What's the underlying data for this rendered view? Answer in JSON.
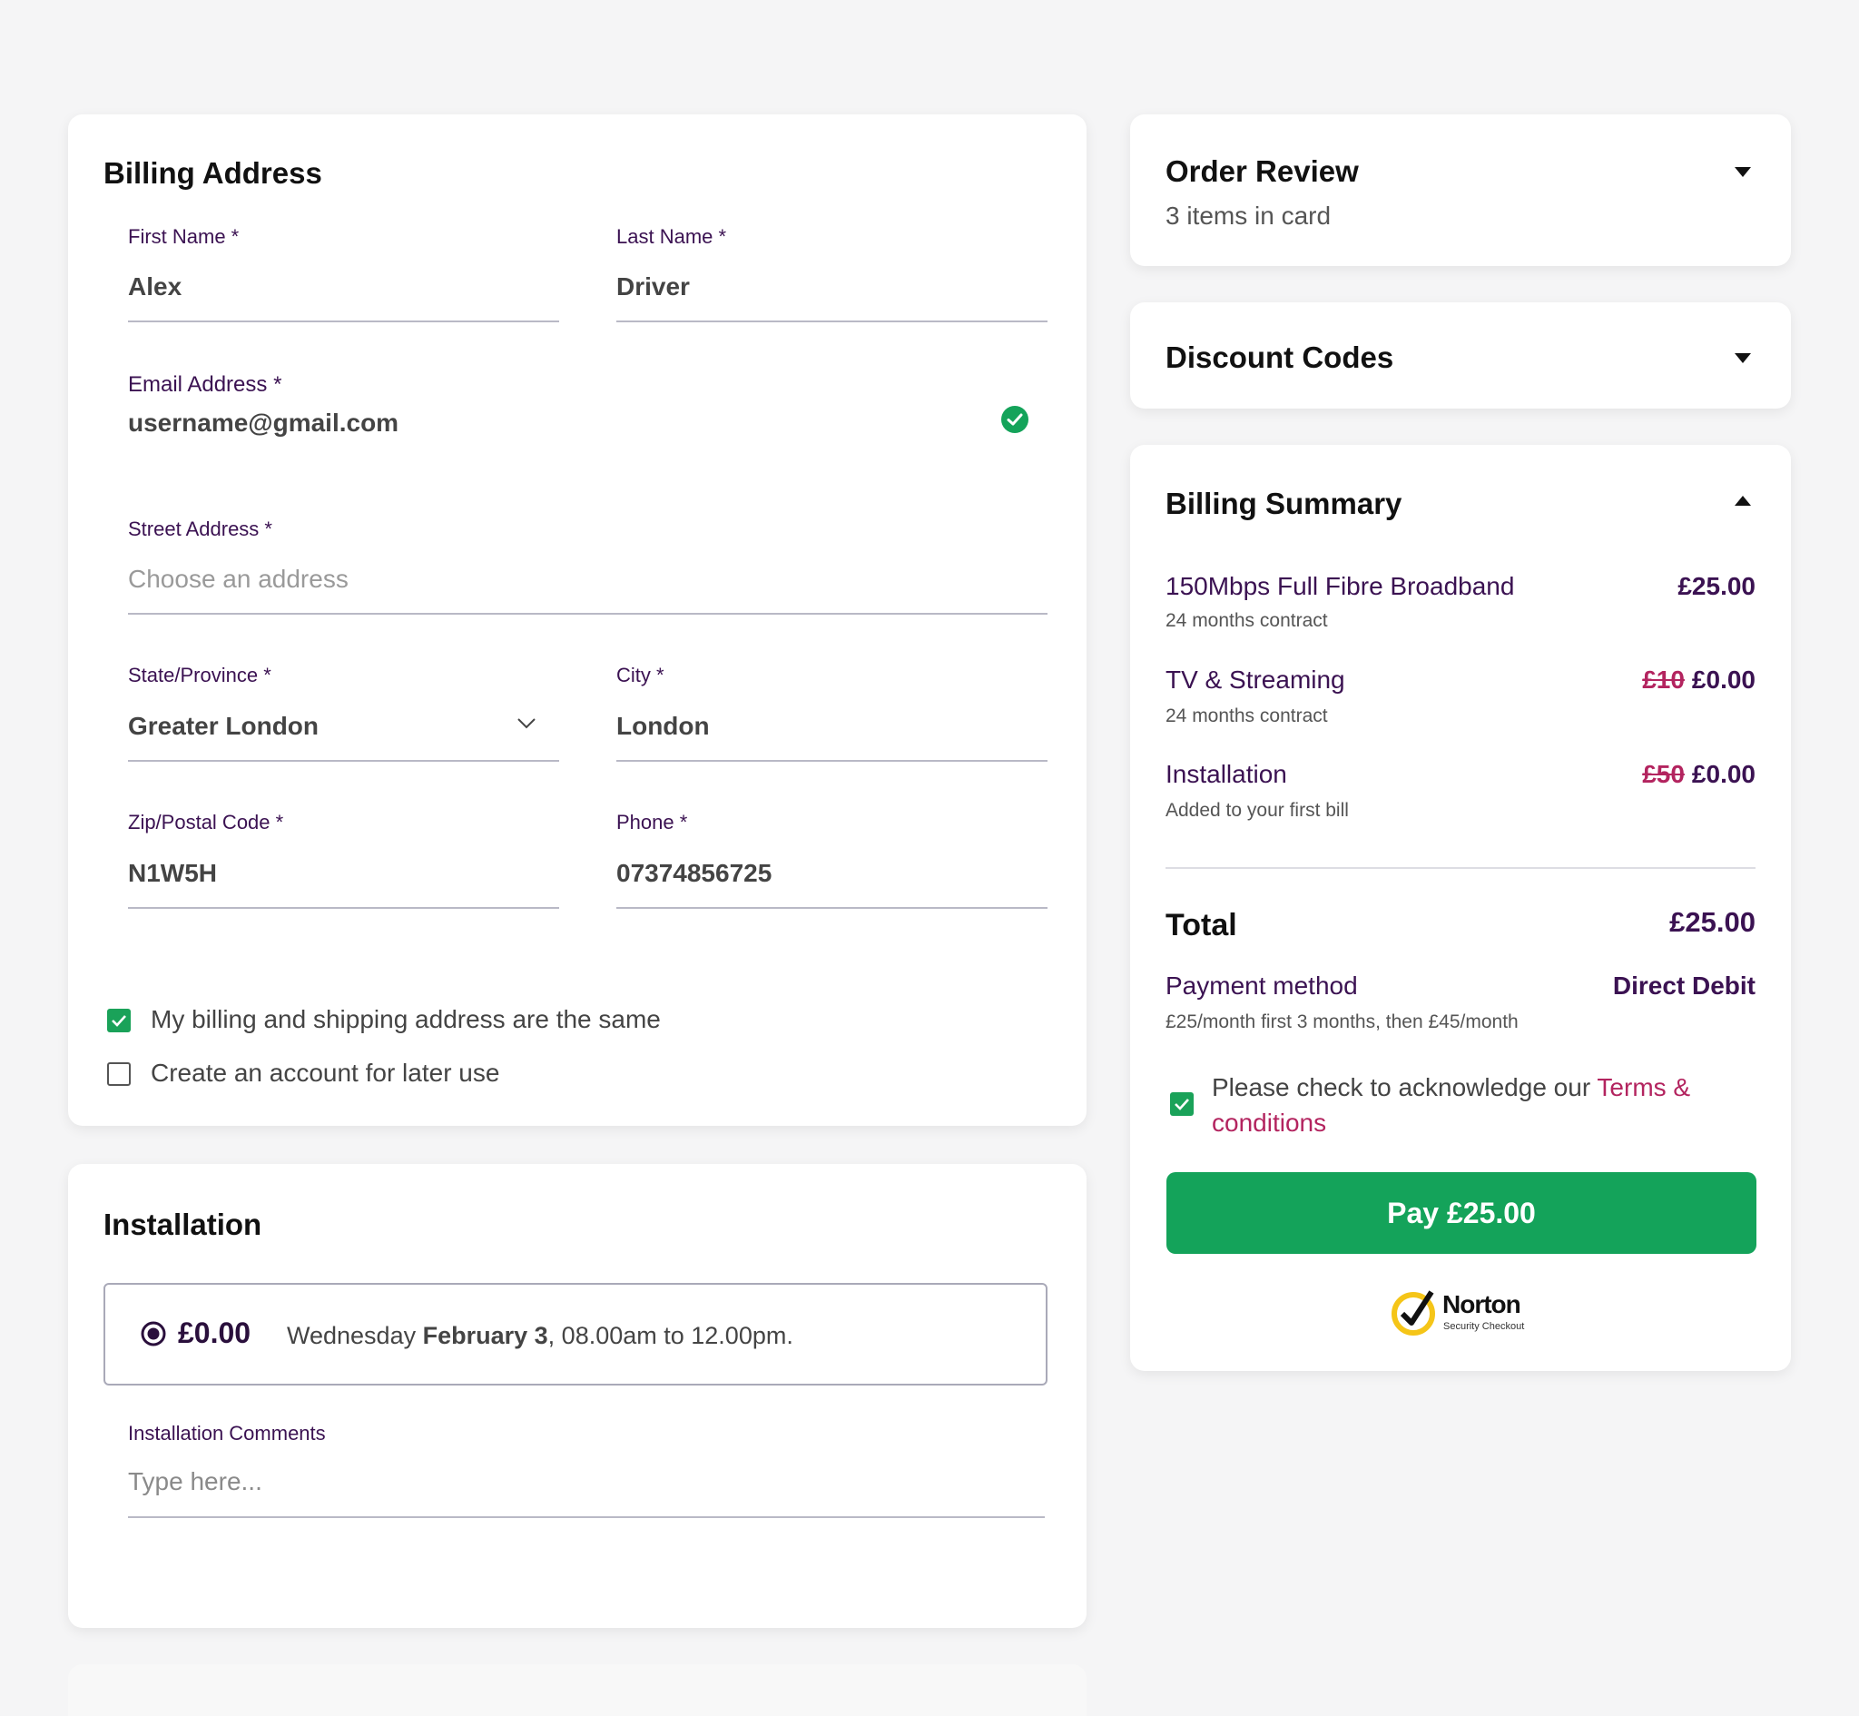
{
  "billing": {
    "title": "Billing Address",
    "first_name": {
      "label": "First Name *",
      "value": "Alex"
    },
    "last_name": {
      "label": "Last Name *",
      "value": "Driver"
    },
    "email": {
      "label": "Email Address *",
      "value": "username@gmail.com"
    },
    "street": {
      "label": "Street Address *",
      "placeholder": "Choose an address"
    },
    "state": {
      "label": "State/Province *",
      "value": "Greater London"
    },
    "city": {
      "label": "City *",
      "value": "London"
    },
    "zip": {
      "label": "Zip/Postal Code *",
      "value": "N1W5H"
    },
    "phone": {
      "label": "Phone *",
      "value": "07374856725"
    },
    "same_address": {
      "label": "My billing and shipping address are the same",
      "checked": true
    },
    "create_account": {
      "label": "Create an account for later use",
      "checked": false
    }
  },
  "installation": {
    "title": "Installation",
    "option_price": "£0.00",
    "option_day": "Wednesday",
    "option_date": "February 3",
    "option_time": ", 08.00am to 12.00pm.",
    "comments_label": "Installation Comments",
    "comments_placeholder": "Type here..."
  },
  "order_review": {
    "title": "Order Review",
    "subtitle": "3 items in card"
  },
  "discount": {
    "title": "Discount Codes"
  },
  "summary": {
    "title": "Billing Summary",
    "items": [
      {
        "name": "150Mbps Full Fibre Broadband",
        "sub": "24 months contract",
        "old": "",
        "price": "£25.00"
      },
      {
        "name": "TV & Streaming",
        "sub": "24 months contract",
        "old": "£10",
        "price": "£0.00"
      },
      {
        "name": "Installation",
        "sub": "Added to your first bill",
        "old": "£50",
        "price": "£0.00"
      }
    ],
    "total_label": "Total",
    "total_value": "£25.00",
    "payment_label": "Payment method",
    "payment_value": "Direct Debit",
    "payment_note": "£25/month first 3 months, then £45/month",
    "terms_prefix": "Please check to acknowledge our ",
    "terms_link": "Terms & conditions",
    "pay_button": "Pay £25.00",
    "norton_name": "Norton",
    "norton_sub": "Security Checkout"
  },
  "colors": {
    "accent_green": "#14a35a",
    "label_purple": "#3b1252",
    "link_pink": "#b3245f",
    "norton_yellow": "#f5c518"
  }
}
